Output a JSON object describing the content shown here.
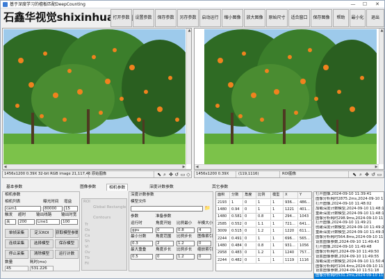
{
  "window": {
    "title": "基于深度学习的檀板匹配DeepCounting",
    "minimize": "—",
    "maximize": "☐",
    "close": "✕"
  },
  "watermark": "石鑫华视觉shixinhua.com",
  "toolbar": [
    "打开参数",
    "设置参数",
    "保存参数",
    "另存参数",
    "启动运行",
    "缩小图像",
    "放大图像",
    "原始尺寸",
    "适合窗口",
    "保存图像",
    "帮助",
    "最小化",
    "退出"
  ],
  "left_image": {
    "status_info": "1456x1200 0.39X 32-bit RGB image 21,117,46",
    "title": "原始图像"
  },
  "right_image": {
    "status_info": "1456x1200 0.39X",
    "coords": "(119,1116)",
    "title": "ROI图像"
  },
  "tabs": [
    "基本参数",
    "图像参数",
    "相机参数",
    "深度计数参数",
    "其它参数"
  ],
  "camera": {
    "section_title": "相机参数",
    "labels": {
      "camera_list": "相机列表",
      "exposure": "曝光时间",
      "gain": "增益",
      "trigger": "触发",
      "timeout": "超时",
      "output_line": "输出线路",
      "output_duration": "输出时宽",
      "count": "数量",
      "time_ms": "耗时(ms)"
    },
    "values": {
      "camera": "cam1",
      "exposure": "80000",
      "gain": "15",
      "trigger": "关",
      "timeout": "200",
      "line": "Line1",
      "duration": "100",
      "count": "45",
      "time_ms": "531.226"
    },
    "buttons": [
      "单帧采集",
      "定义ROI",
      "获取模型参数",
      "连续采集",
      "选择模型",
      "保存模型",
      "停止采集",
      "清除模型",
      "运行计数"
    ]
  },
  "roi": {
    "title": "ROI",
    "tool": "Global Rectangle",
    "contour": "Contours",
    "rows": [
      "Tr",
      "Os",
      "Ca",
      "Sh",
      "Vi",
      "Ov",
      "Tb",
      "Fil"
    ]
  },
  "deep_count": {
    "section_title": "深度计数参数",
    "model_file": "模型文件",
    "param_label": "参数",
    "labels": {
      "runtime": "运行时",
      "min_score": "最小分数",
      "max_overlap": "最大重叠",
      "prep": "准备参数",
      "angle_start": "角度开始",
      "angle_range": "角度范围",
      "angle_step": "角度步长",
      "scale_min": "比例最小",
      "scale_max": "比例步长",
      "scale_step": "比例步长",
      "half_size": "半模大小",
      "img_index": "图像索引",
      "zoom_index": "缩放索引"
    },
    "values": {
      "runtime": "gpu",
      "min_score": "0.3",
      "max_overlap": "0.5",
      "angle_start": "0",
      "angle_range": "2",
      "angle_step": "0",
      "scale_min": "0.8",
      "scale_max": "1.2",
      "scale_step": "1.2",
      "half_size": "4",
      "img_index": "0",
      "zoom_index": "0"
    }
  },
  "results": {
    "headers": [
      "面积",
      "分数",
      "角度",
      "比例",
      "模型",
      "X",
      "Y"
    ],
    "rows": [
      [
        "2193",
        "1",
        "0",
        "1",
        "1",
        "936...",
        "486..."
      ],
      [
        "1480",
        "0.94",
        "0",
        "1",
        "1",
        "1221",
        "401..."
      ],
      [
        "1480",
        "0.581",
        "0",
        "0.8",
        "1",
        "294...",
        "1043"
      ],
      [
        "2585",
        "0.552",
        "0",
        "1.1",
        "1",
        "721...",
        "641..."
      ],
      [
        "3009",
        "0.515",
        "0",
        "1.2",
        "1",
        "1220",
        "611..."
      ],
      [
        "2244",
        "0.491",
        "0",
        "1",
        "1",
        "696...",
        "565..."
      ],
      [
        "1480",
        "0.484",
        "0",
        "0.8",
        "1",
        "931...",
        "1056"
      ],
      [
        "2958",
        "0.483",
        "0",
        "1.2",
        "1",
        "1240",
        "757..."
      ],
      [
        "2244",
        "0.482",
        "0",
        "1",
        "1",
        "1119",
        "1116"
      ]
    ]
  },
  "log": [
    "打开图像,2024-09-10 11:39:41",
    "图像分析耗时2875.2ms,2024-09-10 11:39:",
    "打开图像,2024-09-10 11:48:02",
    "加载深度计数模型,2024-09-10 11:48:12",
    "重新深度计数模型,2024-09-10 11:48:16",
    "图像分析耗时298.9ms,2024-09-10 11:48:",
    "打开图像,2024-09-10 11:49:21",
    "创建深度计数模型,2024-09-10 11:49:24",
    "重新深度计数模型,2024-09-10 11:49:31",
    "图像分析耗时564.8ms,2024-09-10 11:49:3",
    "设置图像参数,2024-09-10 11:49:43",
    "打开图像,2024-09-10 11:49:48",
    "图像分析耗时,2024-09-10 11:49:50",
    "设置图像参数,2024-09-10 11:49:55",
    "加载深度计数模型,2024-09-10 11:50:40",
    "图像分析耗时104.4ms,2024-09-10 11:51:",
    "设置图像参数,2024-09-10 11:51:18",
    "图像分析耗时531.2ms,2024-09-10 11:51:2"
  ],
  "colors": {
    "orange": "#f0821e",
    "selection": "#0078d7"
  }
}
